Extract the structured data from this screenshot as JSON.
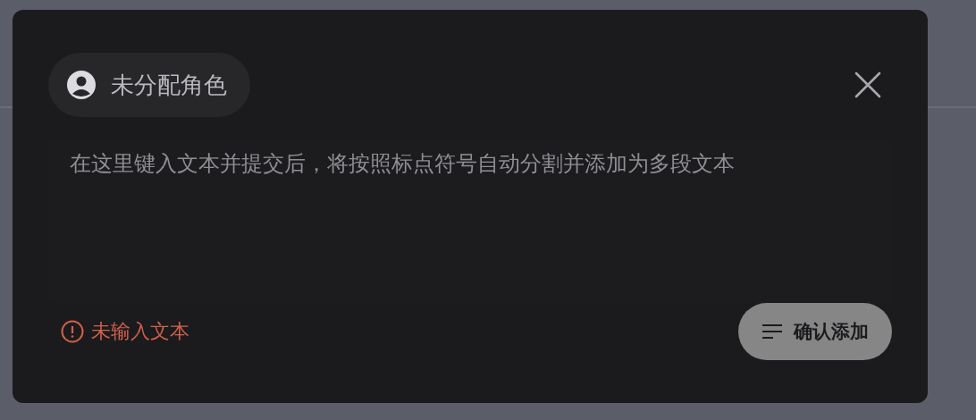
{
  "dialog": {
    "role_chip": {
      "label": "未分配角色"
    },
    "text_field": {
      "placeholder": "在这里键入文本并提交后，将按照标点符号自动分割并添加为多段文本"
    },
    "error": {
      "message": "未输入文本"
    },
    "confirm_button": {
      "label": "确认添加",
      "disabled": true
    }
  }
}
